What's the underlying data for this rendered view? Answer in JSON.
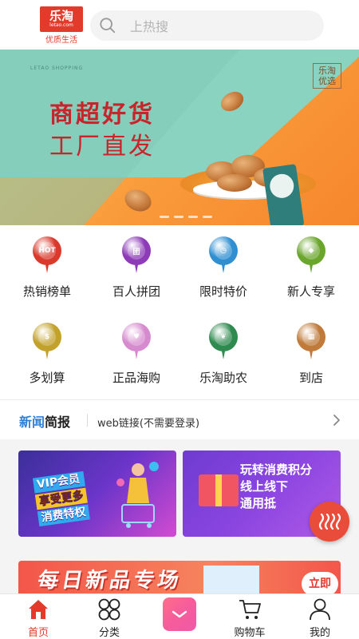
{
  "header": {
    "logo_main": "乐淘",
    "logo_sub": "letao.com",
    "logo_tag": "优质生活",
    "search_placeholder": "上热搜"
  },
  "banner": {
    "brand_en": "LETAO SHOPPING",
    "title_line1": "商超好货",
    "title_line2": "工厂直发",
    "badge": "乐淘优选",
    "badge_line1": "乐淘",
    "badge_line2": "优选",
    "slide_count": 4
  },
  "categories": [
    {
      "label": "热销榜单",
      "icon": "hot-pin-icon",
      "color": "#d93a2c",
      "glyph": "HOT"
    },
    {
      "label": "百人拼团",
      "icon": "group-pin-icon",
      "color": "#8d3bb7",
      "glyph": "团"
    },
    {
      "label": "限时特价",
      "icon": "clock-pin-icon",
      "color": "#2f8fd1",
      "glyph": "◷"
    },
    {
      "label": "新人专享",
      "icon": "newuser-pin-icon",
      "color": "#6aa62c",
      "glyph": "◆"
    },
    {
      "label": "多划算",
      "icon": "deal-pin-icon",
      "color": "#c3a22c",
      "glyph": "$"
    },
    {
      "label": "正品海购",
      "icon": "global-pin-icon",
      "color": "#d78bcf",
      "glyph": "♥"
    },
    {
      "label": "乐淘助农",
      "icon": "farm-pin-icon",
      "color": "#2e8a4e",
      "glyph": "❦"
    },
    {
      "label": "到店",
      "icon": "store-pin-icon",
      "color": "#c07a3a",
      "glyph": "▦"
    }
  ],
  "news": {
    "title_part1": "新闻",
    "title_part2": "简报",
    "text": "web链接(不需要登录)"
  },
  "promos": {
    "vip_line1": "VIP会员",
    "vip_line2": "享受更多",
    "vip_line3": "消费特权",
    "points_line1": "玩转消费积分",
    "points_line2": "线上线下",
    "points_line3": "通用抵"
  },
  "daily": {
    "title": "每日新品专场",
    "button": "立即"
  },
  "tabbar": [
    {
      "label": "首页",
      "icon": "home-icon",
      "active": true
    },
    {
      "label": "分类",
      "icon": "category-icon",
      "active": false
    },
    {
      "label": "",
      "icon": "center-logo-icon",
      "active": false
    },
    {
      "label": "购物车",
      "icon": "cart-icon",
      "active": false
    },
    {
      "label": "我的",
      "icon": "user-icon",
      "active": false
    }
  ],
  "colors": {
    "brand_red": "#e23b2c",
    "news_blue": "#2e7fd6"
  }
}
